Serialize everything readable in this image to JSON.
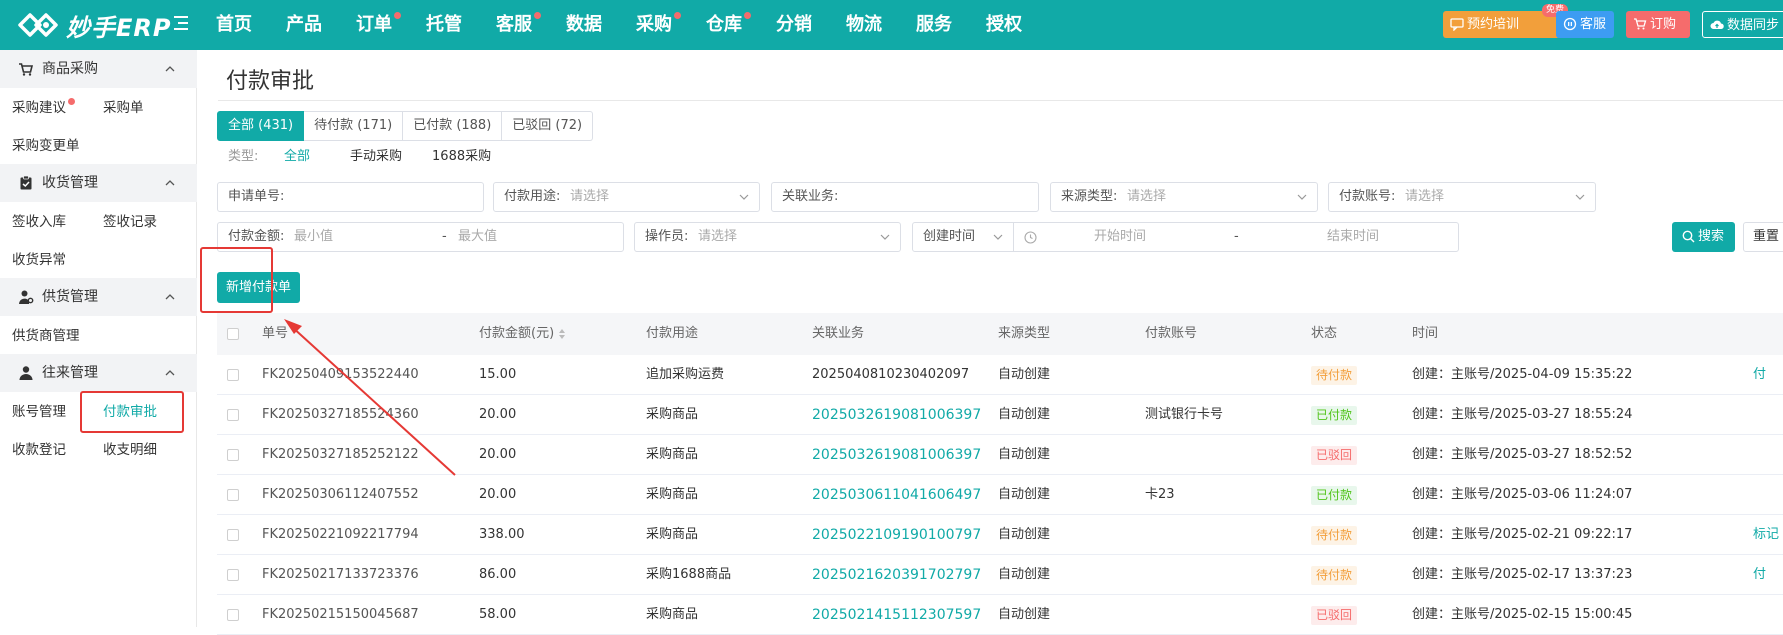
{
  "app": {
    "logo_text": "妙手ERP"
  },
  "nav": [
    {
      "label": "首页",
      "dot": false
    },
    {
      "label": "产品",
      "dot": false
    },
    {
      "label": "订单",
      "dot": true
    },
    {
      "label": "托管",
      "dot": false
    },
    {
      "label": "客服",
      "dot": true
    },
    {
      "label": "数据",
      "dot": false
    },
    {
      "label": "采购",
      "dot": true
    },
    {
      "label": "仓库",
      "dot": true
    },
    {
      "label": "分销",
      "dot": false
    },
    {
      "label": "物流",
      "dot": false
    },
    {
      "label": "服务",
      "dot": false
    },
    {
      "label": "授权",
      "dot": false
    }
  ],
  "top_actions": {
    "training": "预约培训",
    "free_badge": "免费",
    "service": "客服",
    "order": "订购",
    "sync": "数据同步"
  },
  "sidebar": {
    "groups": [
      {
        "label": "商品采购",
        "icon": "cart-icon",
        "items": [
          "采购建议",
          "采购单",
          "采购变更单"
        ]
      },
      {
        "label": "收货管理",
        "icon": "clipboard-check-icon",
        "items": [
          "签收入库",
          "签收记录",
          "收货异常"
        ]
      },
      {
        "label": "供货管理",
        "icon": "user-gear-icon",
        "items": [
          "供货商管理"
        ]
      },
      {
        "label": "往来管理",
        "icon": "user-icon",
        "items": [
          "账号管理",
          "付款审批",
          "收款登记",
          "收支明细"
        ]
      }
    ],
    "active_item": "付款审批"
  },
  "page": {
    "title": "付款审批"
  },
  "tabs": [
    "全部 (431)",
    "待付款 (171)",
    "已付款 (188)",
    "已驳回 (72)"
  ],
  "type_filter": {
    "label": "类型:",
    "options": [
      "全部",
      "手动采购",
      "1688采购"
    ],
    "active": "全部"
  },
  "filters": {
    "apply_no": {
      "label": "申请单号:",
      "placeholder": ""
    },
    "payment_use": {
      "label": "付款用途:",
      "placeholder": "请选择"
    },
    "related_business": {
      "label": "关联业务:",
      "placeholder": ""
    },
    "source_type": {
      "label": "来源类型:",
      "placeholder": "请选择"
    },
    "payment_account": {
      "label": "付款账号:",
      "placeholder": "请选择"
    },
    "amount": {
      "label": "付款金额:",
      "min_placeholder": "最小值",
      "separator": "-",
      "max_placeholder": "最大值"
    },
    "operator": {
      "label": "操作员:",
      "placeholder": "请选择"
    },
    "time_type": {
      "value": "创建时间"
    },
    "time_range": {
      "start_placeholder": "开始时间",
      "separator": "-",
      "end_placeholder": "结束时间"
    },
    "search_label": "搜索",
    "reset_label": "重置"
  },
  "add_button": "新增付款单",
  "table": {
    "headers": [
      "单号",
      "付款金额(元)",
      "付款用途",
      "关联业务",
      "来源类型",
      "付款账号",
      "状态",
      "时间"
    ],
    "rows": [
      {
        "no": "FK20250409153522440",
        "amount": "15.00",
        "use": "追加采购运费",
        "business": "2025040810230402097",
        "business_link": false,
        "source": "自动创建",
        "account": "",
        "status": "待付款",
        "status_kind": "pending",
        "time": "创建：主账号/2025-04-09 15:35:22",
        "action": "付"
      },
      {
        "no": "FK20250327185524360",
        "amount": "20.00",
        "use": "采购商品",
        "business": "2025032619081006397",
        "business_link": true,
        "source": "自动创建",
        "account": "测试银行卡号",
        "status": "已付款",
        "status_kind": "paid",
        "time": "创建：主账号/2025-03-27 18:55:24",
        "action": ""
      },
      {
        "no": "FK20250327185252122",
        "amount": "20.00",
        "use": "采购商品",
        "business": "2025032619081006397",
        "business_link": true,
        "source": "自动创建",
        "account": "",
        "status": "已驳回",
        "status_kind": "rejected",
        "time": "创建：主账号/2025-03-27 18:52:52",
        "action": ""
      },
      {
        "no": "FK20250306112407552",
        "amount": "20.00",
        "use": "采购商品",
        "business": "2025030611041606497",
        "business_link": true,
        "source": "自动创建",
        "account": "卡23",
        "status": "已付款",
        "status_kind": "paid",
        "time": "创建：主账号/2025-03-06 11:24:07",
        "action": ""
      },
      {
        "no": "FK20250221092217794",
        "amount": "338.00",
        "use": "采购商品",
        "business": "2025022109190100797",
        "business_link": true,
        "source": "自动创建",
        "account": "",
        "status": "待付款",
        "status_kind": "pending",
        "time": "创建：主账号/2025-02-21 09:22:17",
        "action": "标记"
      },
      {
        "no": "FK20250217133723376",
        "amount": "86.00",
        "use": "采购1688商品",
        "business": "2025021620391702797",
        "business_link": true,
        "source": "自动创建",
        "account": "",
        "status": "待付款",
        "status_kind": "pending",
        "time": "创建：主账号/2025-02-17 13:37:23",
        "action": "付"
      },
      {
        "no": "FK20250215150045687",
        "amount": "58.00",
        "use": "采购商品",
        "business": "2025021415112307597",
        "business_link": true,
        "source": "自动创建",
        "account": "",
        "status": "已驳回",
        "status_kind": "rejected",
        "time": "创建：主账号/2025-02-15 15:00:45",
        "action": ""
      }
    ]
  },
  "colors": {
    "brand": "#11aaa7",
    "danger": "#f56c6c",
    "warning": "#f29f3b",
    "success": "#52c41a"
  }
}
